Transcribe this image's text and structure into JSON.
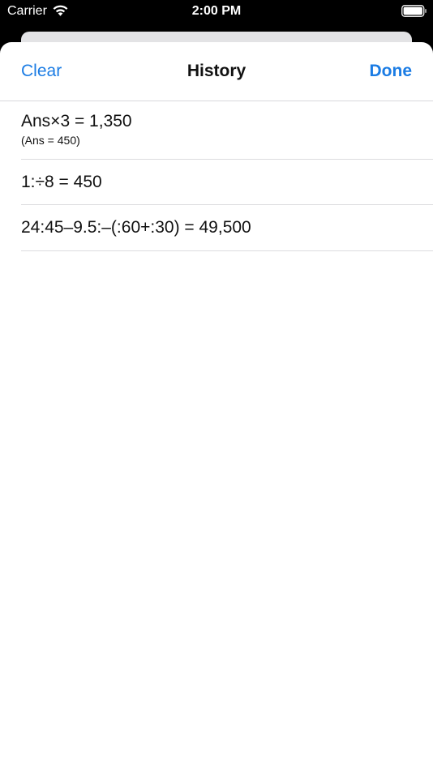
{
  "status_bar": {
    "carrier": "Carrier",
    "time": "2:00 PM",
    "wifi_icon": "wifi-icon",
    "battery_icon": "battery-icon"
  },
  "nav": {
    "clear_label": "Clear",
    "title": "History",
    "done_label": "Done"
  },
  "history": {
    "items": [
      {
        "expression": "Ans×3 = 1,350",
        "detail": "(Ans = 450)"
      },
      {
        "expression": "1:÷8 = 450"
      },
      {
        "expression": "24:45–9.5:–(:60+:30) = 49,500"
      }
    ]
  },
  "colors": {
    "accent": "#1b7ce4",
    "status_bar_bg": "#000000",
    "sheet_bg": "#ffffff",
    "separator": "#dcdcdf"
  }
}
